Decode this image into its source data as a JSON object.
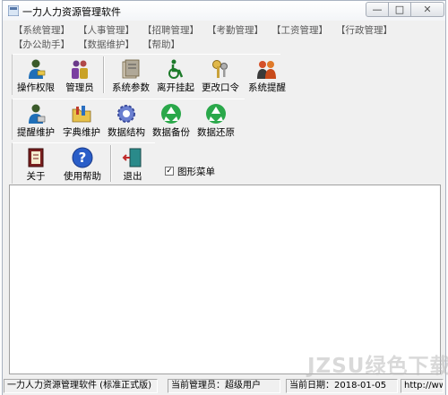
{
  "window": {
    "title": "一力人力资源管理软件",
    "controls": {
      "minimize": "—",
      "maximize": "□",
      "close": "✕"
    }
  },
  "menu": {
    "row1": [
      "【系统管理】",
      "【人事管理】",
      "【招聘管理】",
      "【考勤管理】",
      "【工资管理】",
      "【行政管理】"
    ],
    "row2": [
      "【办公助手】",
      "【数据维护】",
      "【帮助】"
    ]
  },
  "toolbar1": [
    "操作权限",
    "管理员",
    "系统参数",
    "离开挂起",
    "更改口令",
    "系统提醒"
  ],
  "toolbar2": [
    "提醒维护",
    "字典维护",
    "数据结构",
    "数据备份",
    "数据还原"
  ],
  "toolbar3": [
    "关于",
    "使用帮助",
    "退出"
  ],
  "graphic_menu": {
    "label": "图形菜单",
    "checked": true,
    "mark": "✓"
  },
  "statusbar": {
    "app": "一力人力资源管理软件 (标准正式版)",
    "admin": "当前管理员：超级用户",
    "date": "当前日期：2018-01-05",
    "url": "http://ww"
  },
  "watermark": "JZSU绿色下载",
  "colors": {
    "menu_text": "#5a5a5a",
    "window_bg": "#f0f0f0",
    "work_bg": "#ffffff"
  }
}
